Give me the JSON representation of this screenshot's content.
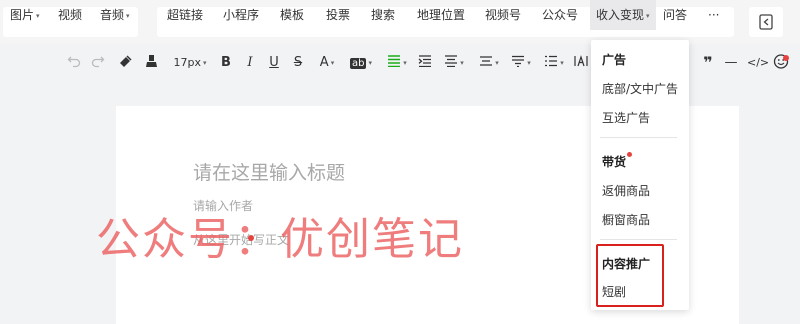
{
  "topbar": {
    "group1": [
      {
        "label": "图片",
        "caret": true
      },
      {
        "label": "视频",
        "caret": false
      },
      {
        "label": "音频",
        "caret": true
      }
    ],
    "group2": [
      {
        "label": "超链接",
        "caret": false
      },
      {
        "label": "小程序",
        "caret": false
      },
      {
        "label": "模板",
        "caret": false
      },
      {
        "label": "投票",
        "caret": false
      },
      {
        "label": "搜索",
        "caret": false
      },
      {
        "label": "地理位置",
        "caret": false
      },
      {
        "label": "视频号",
        "caret": false
      },
      {
        "label": "公众号",
        "caret": false
      },
      {
        "label": "收入变现",
        "caret": true,
        "active": true
      },
      {
        "label": "问答",
        "caret": false
      },
      {
        "label": "···",
        "caret": false
      }
    ]
  },
  "toolbar": {
    "font_size": "17px",
    "icons": [
      "undo-icon",
      "redo-icon",
      "format-brush-icon",
      "clear-format-icon",
      "bold-icon",
      "italic-icon",
      "underline-icon",
      "strikethrough-icon",
      "font-color-icon",
      "background-color-icon",
      "align-icon",
      "indent-icon",
      "center-icon",
      "line-height-icon",
      "paragraph-spacing-icon",
      "list-icon",
      "text-direction-icon",
      "quote-icon",
      "divider-icon",
      "code-icon",
      "emoji-icon"
    ],
    "bold": "B",
    "italic": "I",
    "underline": "U",
    "strike": "S",
    "font_color": "A",
    "bg_color": "ab",
    "quote": "❞",
    "divider": "—",
    "code": "</>"
  },
  "editor": {
    "title_placeholder": "请在这里输入标题",
    "author_placeholder": "请输入作者",
    "body_placeholder": "从这里开始写正文"
  },
  "watermark": "公众号：优创笔记",
  "dropdown": {
    "sections": [
      {
        "heading": "广告",
        "items": [
          "底部/文中广告",
          "互选广告"
        ]
      },
      {
        "heading": "带货",
        "items": [
          "返佣商品",
          "橱窗商品"
        ]
      },
      {
        "heading": "内容推广",
        "items": [
          "短剧"
        ]
      }
    ]
  },
  "colors": {
    "accent_green": "#1aad19",
    "highlight_red": "#d9201c",
    "watermark_red": "#ec6060"
  }
}
